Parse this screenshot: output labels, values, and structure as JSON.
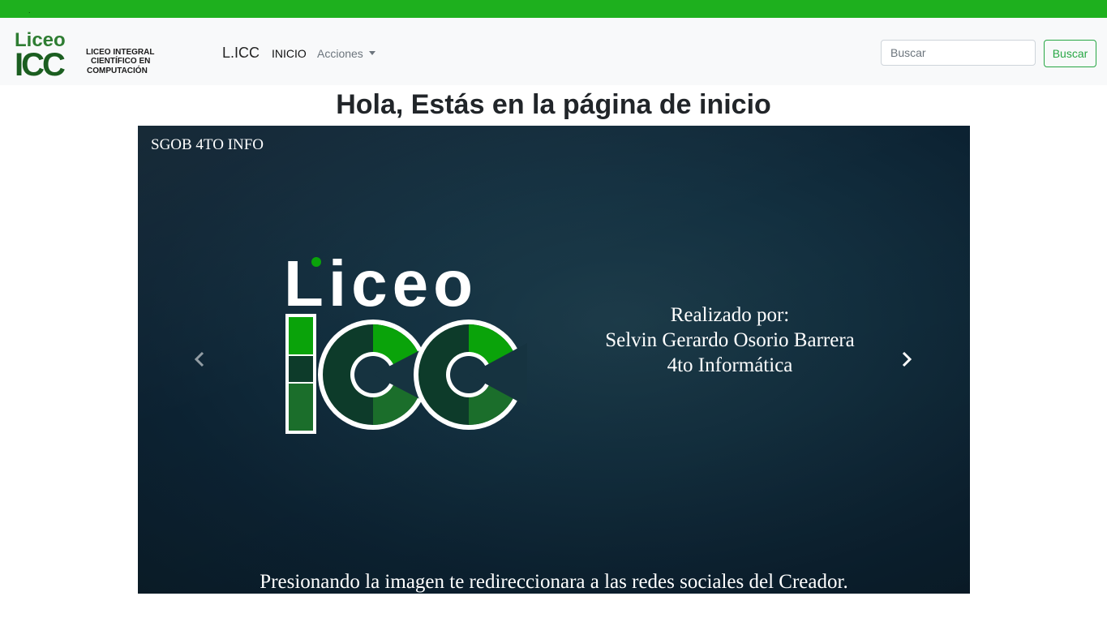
{
  "colors": {
    "topbar": "#1eb01e",
    "navbar_bg": "#f8f9fa",
    "accent_success": "#28a745",
    "logo_green_dark": "#1b5e20",
    "logo_green_bright": "#0aa30a"
  },
  "logo": {
    "word_top": "Liceo",
    "word_bottom": "ICC",
    "lines": [
      "LICEO INTEGRAL",
      "CIENTÍFICO EN",
      "COMPUTACIÓN"
    ]
  },
  "topbar": {
    "dot": "."
  },
  "navbar": {
    "brand": "L.ICC",
    "nav_items": [
      {
        "label": "INICIO"
      },
      {
        "label": "Acciones"
      }
    ],
    "search": {
      "placeholder": "Buscar",
      "button_label": "Buscar"
    }
  },
  "main": {
    "title": "Hola, Estás en la página de inicio",
    "carousel": {
      "tag": "SGOB 4TO INFO",
      "credits": [
        "Realizado por:",
        "Selvin Gerardo Osorio Barrera",
        "4to Informática"
      ],
      "caption": "Presionando la imagen te redireccionara a las redes sociales del Creador.",
      "prev_icon": "chevron-left-icon",
      "next_icon": "chevron-right-icon"
    }
  }
}
